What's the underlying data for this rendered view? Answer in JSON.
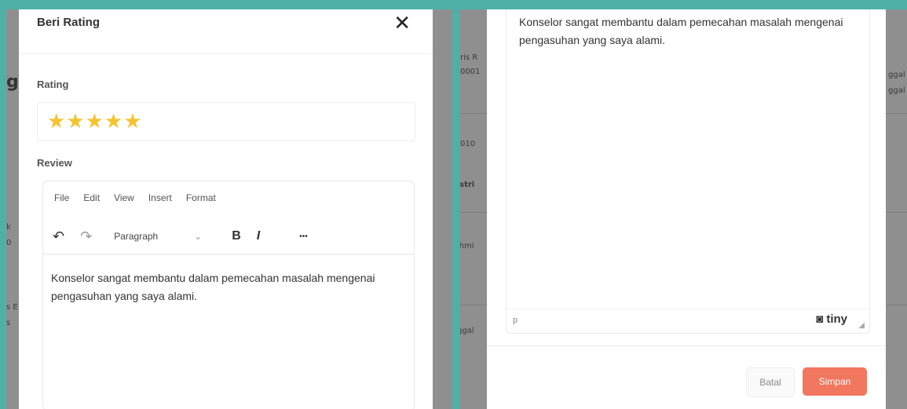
{
  "left": {
    "title": "Beri Rating",
    "close_symbol": "✕",
    "rating_label": "Rating",
    "rating_value": 5,
    "rating_max": 5,
    "stars_text": "★★★★★",
    "star_color": "#f4c430",
    "review_label": "Review",
    "menu": [
      "File",
      "Edit",
      "View",
      "Insert",
      "Format"
    ],
    "block_format": "Paragraph",
    "toolbar": {
      "undo_icon": "↶",
      "redo_icon": "↷",
      "bold": "B",
      "italic": "I",
      "more": "•••",
      "dropdown_icon": "⌄"
    },
    "content": "Konselor sangat membantu dalam pemecahan masalah mengenai pengasuhan yang saya alami."
  },
  "right": {
    "content": "Konselor sangat membantu dalam pemecahan masalah mengenai pengasuhan yang saya alami.",
    "status_path": "p",
    "brand": "tiny",
    "brand_icon": "◙",
    "cancel_label": "Batal",
    "save_label": "Simpan",
    "save_color": "#f2775f"
  },
  "background": {
    "left_heading_fragment": "g",
    "left_fragments": [
      "k",
      "0",
      "s E",
      "s"
    ],
    "right_fragments": [
      "ris R",
      "0001",
      "010",
      "ustri",
      "'hmi",
      "ggal",
      "ggal",
      "ggal"
    ]
  }
}
